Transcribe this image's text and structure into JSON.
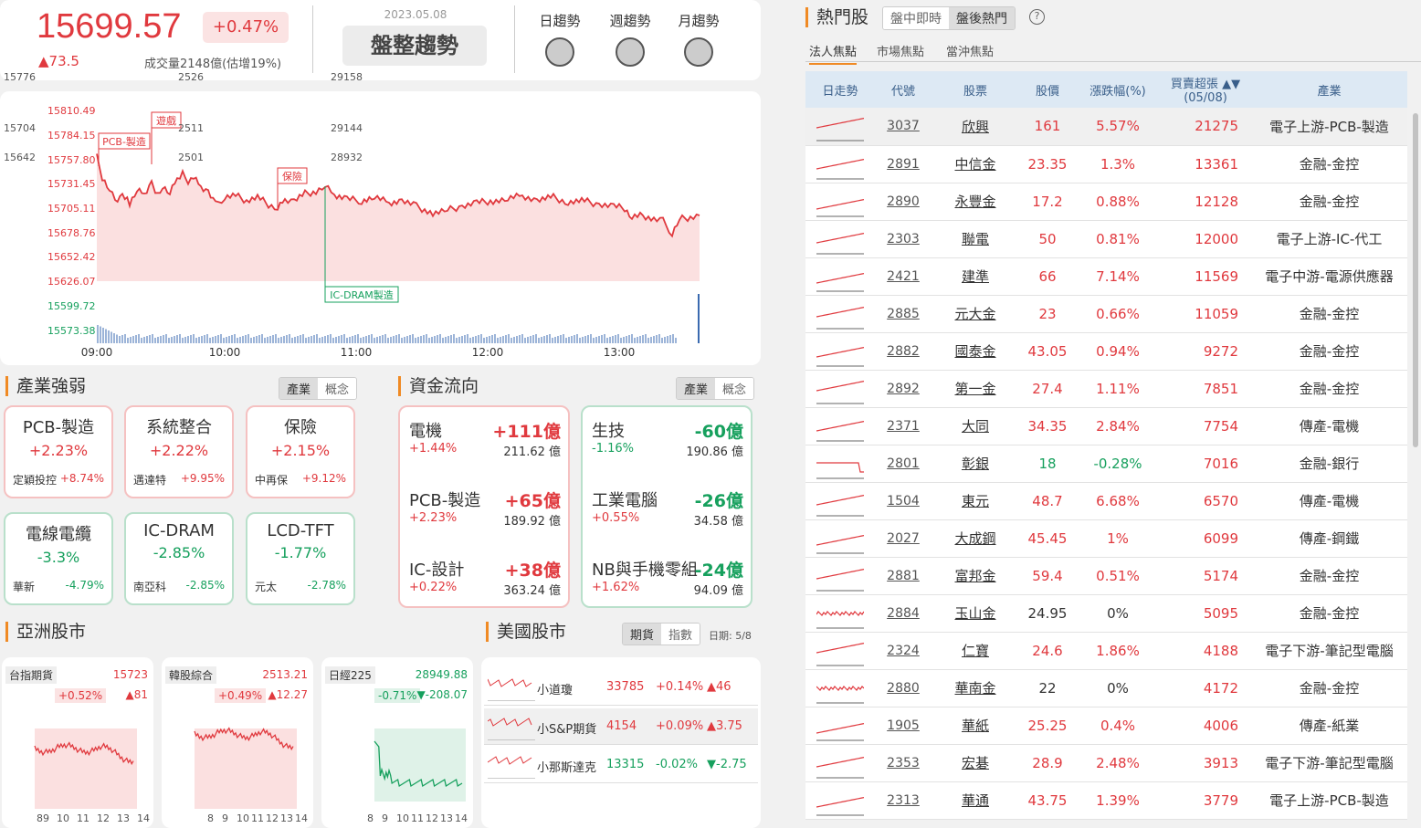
{
  "index": {
    "value": "15699.57",
    "pct": "+0.47%",
    "change": "▲73.5",
    "volume": "成交量2148億(估增19%)"
  },
  "trend": {
    "date": "2023.05.08",
    "label": "盤整趨勢",
    "daily": "日趨勢",
    "weekly": "週趨勢",
    "monthly": "月趨勢"
  },
  "chart_data": {
    "type": "line",
    "y_ticks": [
      "15810.49",
      "15784.15",
      "15757.80",
      "15731.45",
      "15705.11",
      "15678.76",
      "15652.42",
      "15626.07",
      "15599.72",
      "15573.38"
    ],
    "x_ticks": [
      "09:00",
      "10:00",
      "11:00",
      "12:00",
      "13:00"
    ],
    "ylim": [
      15573.38,
      15810.49
    ],
    "annotations": [
      "PCB-製造",
      "遊戲",
      "保險",
      "IC-DRAM製造"
    ]
  },
  "industry": {
    "title": "產業強弱",
    "tabs": [
      "產業",
      "概念"
    ],
    "items": [
      {
        "name": "PCB-製造",
        "pct": "+2.23%",
        "sub": "定穎投控",
        "subpct": "+8.74%"
      },
      {
        "name": "系統整合",
        "pct": "+2.22%",
        "sub": "邁達特",
        "subpct": "+9.95%"
      },
      {
        "name": "保險",
        "pct": "+2.15%",
        "sub": "中再保",
        "subpct": "+9.12%"
      },
      {
        "name": "電線電纜",
        "pct": "-3.3%",
        "sub": "華新",
        "subpct": "-4.79%"
      },
      {
        "name": "IC-DRAM",
        "pct": "-2.85%",
        "sub": "南亞科",
        "subpct": "-2.85%"
      },
      {
        "name": "LCD-TFT",
        "pct": "-1.77%",
        "sub": "元太",
        "subpct": "-2.78%"
      }
    ]
  },
  "fund": {
    "title": "資金流向",
    "tabs": [
      "產業",
      "概念"
    ],
    "inflow": [
      {
        "name": "電機",
        "amt": "+111億",
        "pct": "+1.44%",
        "total": "211.62 億"
      },
      {
        "name": "PCB-製造",
        "amt": "+65億",
        "pct": "+2.23%",
        "total": "189.92 億"
      },
      {
        "name": "IC-設計",
        "amt": "+38億",
        "pct": "+0.22%",
        "total": "363.24 億"
      }
    ],
    "outflow": [
      {
        "name": "生技",
        "amt": "-60億",
        "pct": "-1.16%",
        "total": "190.86 億"
      },
      {
        "name": "工業電腦",
        "amt": "-26億",
        "pct": "+0.55%",
        "total": "34.58 億"
      },
      {
        "name": "NB與手機零組",
        "amt": "-24億",
        "pct": "+1.62%",
        "total": "94.09 億"
      }
    ]
  },
  "asia": {
    "title": "亞洲股市",
    "markets": [
      {
        "name": "台指期貨",
        "value": "15723",
        "pct": "+0.52%",
        "chg": "▲81",
        "y": [
          "15776",
          "15704",
          "15642"
        ],
        "x": [
          "89",
          "10",
          "11",
          "12",
          "13",
          "14"
        ]
      },
      {
        "name": "韓股綜合",
        "value": "2513.21",
        "pct": "+0.49%",
        "chg": "▲12.27",
        "y": [
          "2526",
          "2511",
          "2501"
        ],
        "x": [
          "8",
          "9",
          "10",
          "11",
          "12",
          "13",
          "14"
        ]
      },
      {
        "name": "日經225",
        "value": "28949.88",
        "pct": "-0.71%",
        "chg": "▼-208.07",
        "y": [
          "29158",
          "29144",
          "28932"
        ],
        "x": [
          "8",
          "9",
          "10",
          "11",
          "12",
          "13",
          "14"
        ]
      }
    ]
  },
  "us": {
    "title": "美國股市",
    "tabs": [
      "期貨",
      "指數"
    ],
    "date": "日期: 5/8",
    "rows": [
      {
        "name": "小道瓊",
        "value": "33785",
        "pct": "+0.14%",
        "chg": "▲46"
      },
      {
        "name": "小S&P期貨",
        "value": "4154",
        "pct": "+0.09%",
        "chg": "▲3.75"
      },
      {
        "name": "小那斯達克",
        "value": "13315",
        "pct": "-0.02%",
        "chg": "▼-2.75"
      }
    ]
  },
  "hot": {
    "title": "熱門股",
    "modes": [
      "盤中即時",
      "盤後熱門"
    ],
    "help": "?",
    "subtabs": [
      "法人焦點",
      "市場焦點",
      "當沖焦點"
    ],
    "headers": [
      "日走勢",
      "代號",
      "股票",
      "股價",
      "漲跌幅(%)",
      "買賣超張",
      "(05/08)",
      "產業"
    ],
    "rows": [
      {
        "code": "3037",
        "name": "欣興",
        "price": "161",
        "pct": "5.57%",
        "buy": "21275",
        "ind": "電子上游-PCB-製造",
        "dir": "up"
      },
      {
        "code": "2891",
        "name": "中信金",
        "price": "23.35",
        "pct": "1.3%",
        "buy": "13361",
        "ind": "金融-金控",
        "dir": "up"
      },
      {
        "code": "2890",
        "name": "永豐金",
        "price": "17.2",
        "pct": "0.88%",
        "buy": "12128",
        "ind": "金融-金控",
        "dir": "up"
      },
      {
        "code": "2303",
        "name": "聯電",
        "price": "50",
        "pct": "0.81%",
        "buy": "12000",
        "ind": "電子上游-IC-代工",
        "dir": "up"
      },
      {
        "code": "2421",
        "name": "建準",
        "price": "66",
        "pct": "7.14%",
        "buy": "11569",
        "ind": "電子中游-電源供應器",
        "dir": "up"
      },
      {
        "code": "2885",
        "name": "元大金",
        "price": "23",
        "pct": "0.66%",
        "buy": "11059",
        "ind": "金融-金控",
        "dir": "up"
      },
      {
        "code": "2882",
        "name": "國泰金",
        "price": "43.05",
        "pct": "0.94%",
        "buy": "9272",
        "ind": "金融-金控",
        "dir": "up"
      },
      {
        "code": "2892",
        "name": "第一金",
        "price": "27.4",
        "pct": "1.11%",
        "buy": "7851",
        "ind": "金融-金控",
        "dir": "up"
      },
      {
        "code": "2371",
        "name": "大同",
        "price": "34.35",
        "pct": "2.84%",
        "buy": "7754",
        "ind": "傳產-電機",
        "dir": "up"
      },
      {
        "code": "2801",
        "name": "彰銀",
        "price": "18",
        "pct": "-0.28%",
        "buy": "7016",
        "ind": "金融-銀行",
        "dir": "down"
      },
      {
        "code": "1504",
        "name": "東元",
        "price": "48.7",
        "pct": "6.68%",
        "buy": "6570",
        "ind": "傳產-電機",
        "dir": "up"
      },
      {
        "code": "2027",
        "name": "大成鋼",
        "price": "45.45",
        "pct": "1%",
        "buy": "6099",
        "ind": "傳產-鋼鐵",
        "dir": "up"
      },
      {
        "code": "2881",
        "name": "富邦金",
        "price": "59.4",
        "pct": "0.51%",
        "buy": "5174",
        "ind": "金融-金控",
        "dir": "up"
      },
      {
        "code": "2884",
        "name": "玉山金",
        "price": "24.95",
        "pct": "0%",
        "buy": "5095",
        "ind": "金融-金控",
        "dir": "flat"
      },
      {
        "code": "2324",
        "name": "仁寶",
        "price": "24.6",
        "pct": "1.86%",
        "buy": "4188",
        "ind": "電子下游-筆記型電腦",
        "dir": "up"
      },
      {
        "code": "2880",
        "name": "華南金",
        "price": "22",
        "pct": "0%",
        "buy": "4172",
        "ind": "金融-金控",
        "dir": "flat"
      },
      {
        "code": "1905",
        "name": "華紙",
        "price": "25.25",
        "pct": "0.4%",
        "buy": "4006",
        "ind": "傳產-紙業",
        "dir": "up"
      },
      {
        "code": "2353",
        "name": "宏碁",
        "price": "28.9",
        "pct": "2.48%",
        "buy": "3913",
        "ind": "電子下游-筆記型電腦",
        "dir": "up"
      },
      {
        "code": "2313",
        "name": "華通",
        "price": "43.75",
        "pct": "1.39%",
        "buy": "3779",
        "ind": "電子上游-PCB-製造",
        "dir": "up"
      }
    ]
  }
}
